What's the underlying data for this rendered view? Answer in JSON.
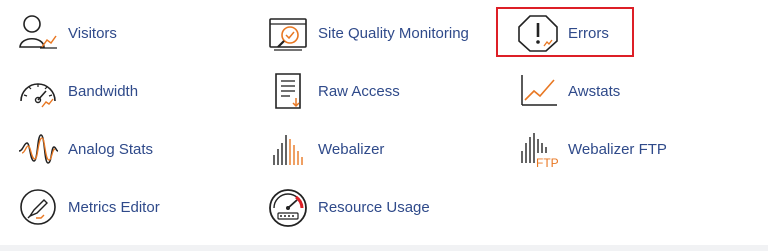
{
  "metrics": {
    "items": [
      {
        "label": "Visitors",
        "icon": "visitors-icon"
      },
      {
        "label": "Site Quality Monitoring",
        "icon": "site-quality-icon"
      },
      {
        "label": "Errors",
        "icon": "errors-icon"
      },
      {
        "label": "Bandwidth",
        "icon": "bandwidth-icon"
      },
      {
        "label": "Raw Access",
        "icon": "raw-access-icon"
      },
      {
        "label": "Awstats",
        "icon": "awstats-icon"
      },
      {
        "label": "Analog Stats",
        "icon": "analog-stats-icon"
      },
      {
        "label": "Webalizer",
        "icon": "webalizer-icon"
      },
      {
        "label": "Webalizer FTP",
        "icon": "webalizer-ftp-icon"
      },
      {
        "label": "Metrics Editor",
        "icon": "metrics-editor-icon"
      },
      {
        "label": "Resource Usage",
        "icon": "resource-usage-icon"
      }
    ],
    "ftp_badge": "FTP"
  },
  "colors": {
    "label": "#2f4a8a",
    "accent": "#e87722",
    "highlight": "#dd1f26",
    "icon_stroke": "#222222"
  }
}
